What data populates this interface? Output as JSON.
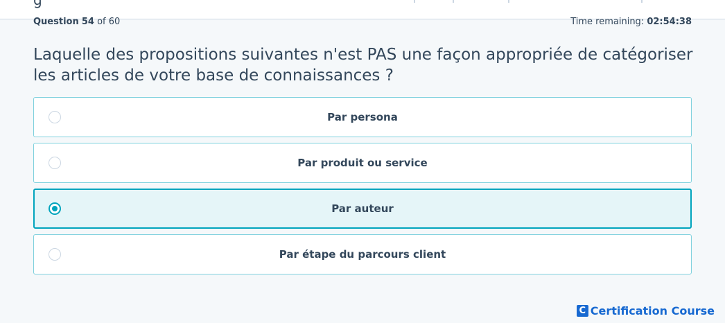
{
  "quiz": {
    "question_label": "Question",
    "question_number": "54",
    "of_label": "of",
    "question_total": "60",
    "timer_label": "Time remaining:",
    "timer_value": "02:54:38",
    "question_text": "Laquelle des propositions suivantes n'est PAS une façon appropriée de catégoriser les articles de votre base de connaissances ?",
    "answers": [
      {
        "label": "Par persona",
        "selected": false
      },
      {
        "label": "Par produit ou service",
        "selected": false
      },
      {
        "label": "Par auteur",
        "selected": true
      },
      {
        "label": "Par étape du parcours client",
        "selected": false
      }
    ]
  },
  "brand": {
    "icon_letter": "C",
    "text": "Certification Course",
    "color": "#1769d1"
  },
  "colors": {
    "accent": "#00a4bd",
    "selected_bg": "#e5f5f8",
    "text": "#33475b"
  }
}
